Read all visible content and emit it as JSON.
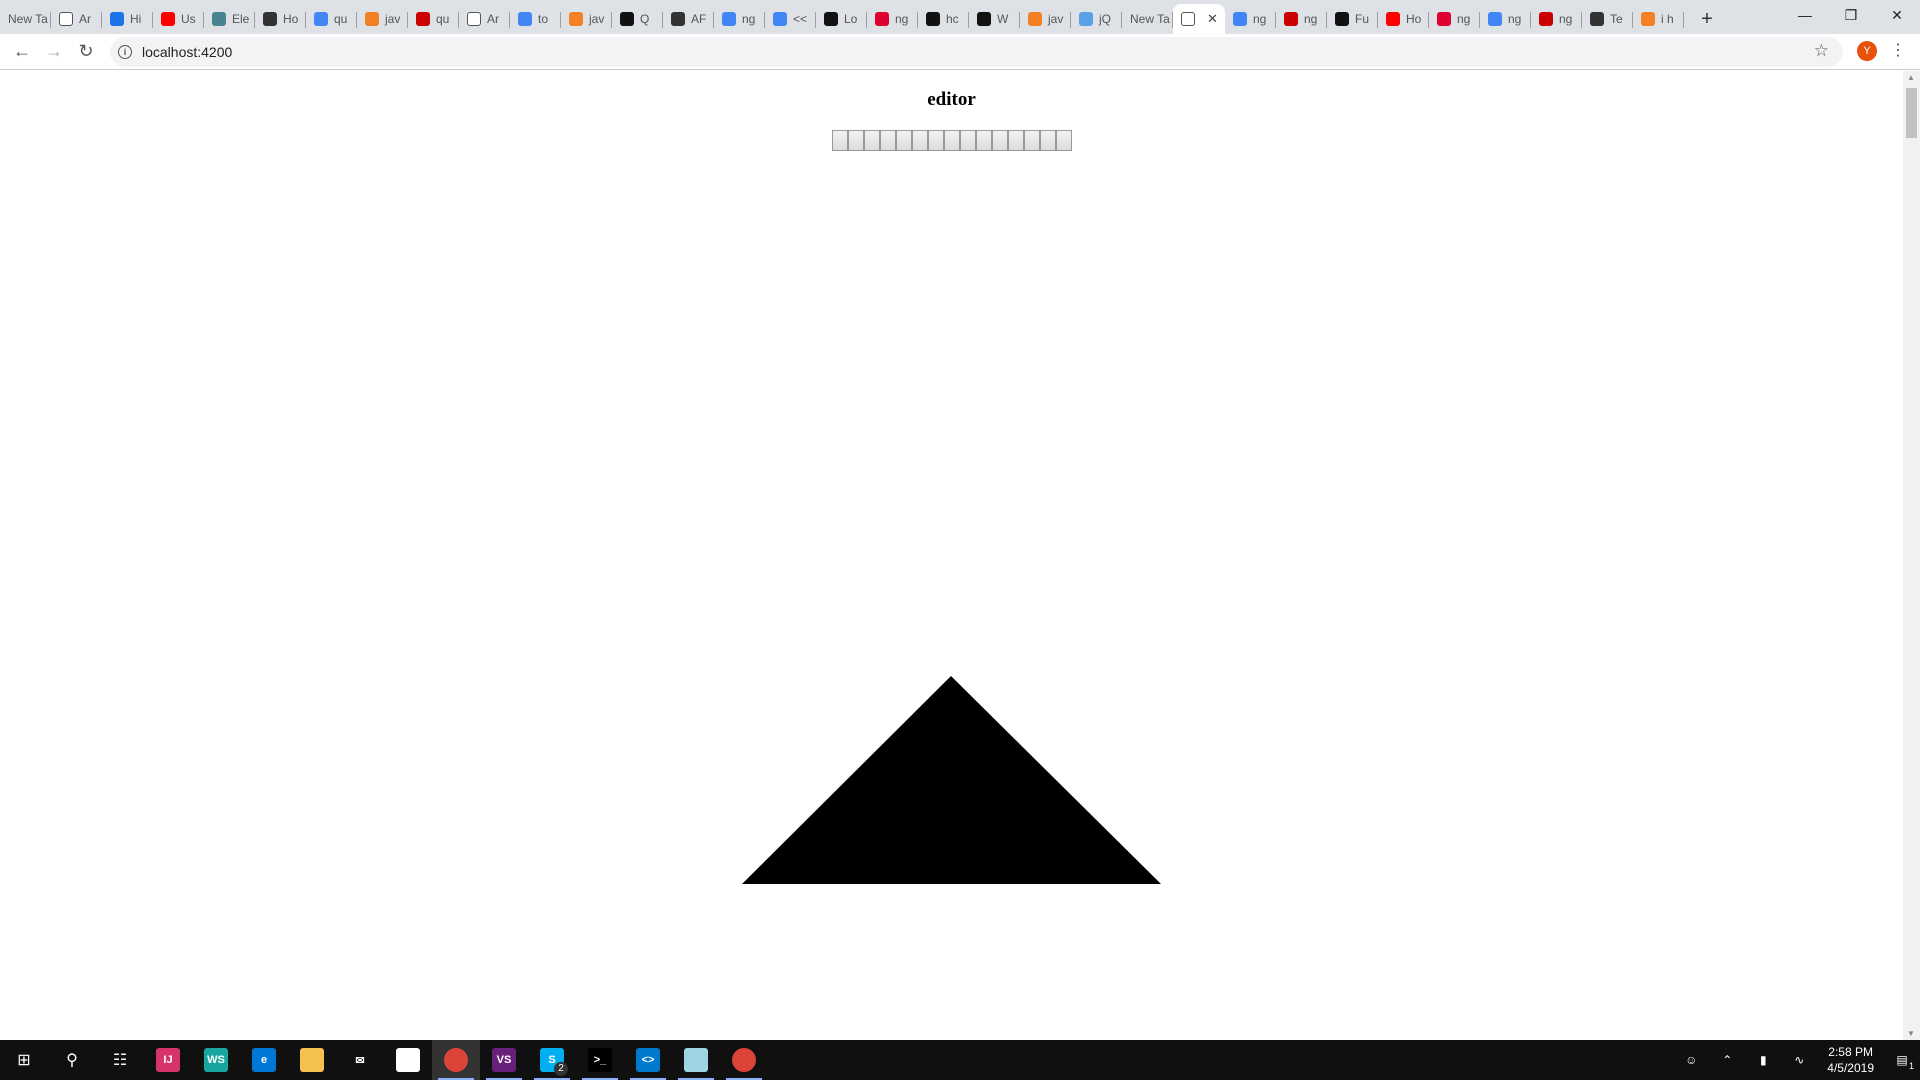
{
  "browser": {
    "tabs": [
      {
        "label": "New Ta",
        "icon": "none"
      },
      {
        "label": "Ar",
        "icon": "page-icon"
      },
      {
        "label": "Hi",
        "icon": "history-icon"
      },
      {
        "label": "Us",
        "icon": "youtube-icon"
      },
      {
        "label": "Ele",
        "icon": "electron-icon"
      },
      {
        "label": "Ho",
        "icon": "pin-icon"
      },
      {
        "label": "qu",
        "icon": "google-icon"
      },
      {
        "label": "jav",
        "icon": "stackoverflow-icon"
      },
      {
        "label": "qu",
        "icon": "npm-icon"
      },
      {
        "label": "Ar",
        "icon": "page-icon"
      },
      {
        "label": "to",
        "icon": "google-icon"
      },
      {
        "label": "jav",
        "icon": "stackoverflow-icon"
      },
      {
        "label": "Q",
        "icon": "github-icon"
      },
      {
        "label": "AF",
        "icon": "pin-icon"
      },
      {
        "label": "ng",
        "icon": "google-icon"
      },
      {
        "label": "<<",
        "icon": "google-icon"
      },
      {
        "label": "Lo",
        "icon": "github-icon"
      },
      {
        "label": "ng",
        "icon": "angular-icon"
      },
      {
        "label": "hc",
        "icon": "github-icon"
      },
      {
        "label": "W",
        "icon": "github-icon"
      },
      {
        "label": "jav",
        "icon": "stackoverflow-icon"
      },
      {
        "label": "jQ",
        "icon": "cloud-icon"
      },
      {
        "label": "New Ta",
        "icon": "none"
      },
      {
        "label": "",
        "icon": "page-icon",
        "active": true
      },
      {
        "label": "ng",
        "icon": "google-icon"
      },
      {
        "label": "ng",
        "icon": "npm-icon"
      },
      {
        "label": "Fu",
        "icon": "github-icon"
      },
      {
        "label": "Ho",
        "icon": "youtube-icon"
      },
      {
        "label": "ng",
        "icon": "angular-icon"
      },
      {
        "label": "ng",
        "icon": "google-icon"
      },
      {
        "label": "ng",
        "icon": "npm-icon"
      },
      {
        "label": "Te",
        "icon": "download-icon"
      },
      {
        "label": "i h",
        "icon": "stackoverflow-icon"
      }
    ],
    "new_tab": "+",
    "url": "localhost:4200",
    "avatar_letter": "Y"
  },
  "page": {
    "title": "editor",
    "toolbar_button_count": 15,
    "shape": "triangle",
    "shape_color": "#000000"
  },
  "taskbar": {
    "apps": [
      {
        "name": "intellij",
        "label": "IJ",
        "color": "#d6336c"
      },
      {
        "name": "webstorm",
        "label": "WS",
        "color": "#17a6a0"
      },
      {
        "name": "edge",
        "label": "e",
        "color": "#0078d7"
      },
      {
        "name": "file-explorer",
        "label": "",
        "color": "#f2c14e"
      },
      {
        "name": "mail",
        "label": "✉",
        "color": "#101010"
      },
      {
        "name": "store",
        "label": "",
        "color": "#ffffff"
      },
      {
        "name": "chrome",
        "label": "",
        "color": "#db4437",
        "active": true
      },
      {
        "name": "visual-studio",
        "label": "VS",
        "color": "#68217a"
      },
      {
        "name": "skype",
        "label": "S",
        "color": "#00aff0",
        "badge": "2"
      },
      {
        "name": "cmd",
        "label": ">_",
        "color": "#000000"
      },
      {
        "name": "vscode",
        "label": "<>",
        "color": "#007acc"
      },
      {
        "name": "notepad",
        "label": "",
        "color": "#9fd3e6"
      },
      {
        "name": "chrome-2",
        "label": "",
        "color": "#db4437"
      }
    ],
    "time": "2:58 PM",
    "date": "4/5/2019",
    "notifications": "1"
  }
}
